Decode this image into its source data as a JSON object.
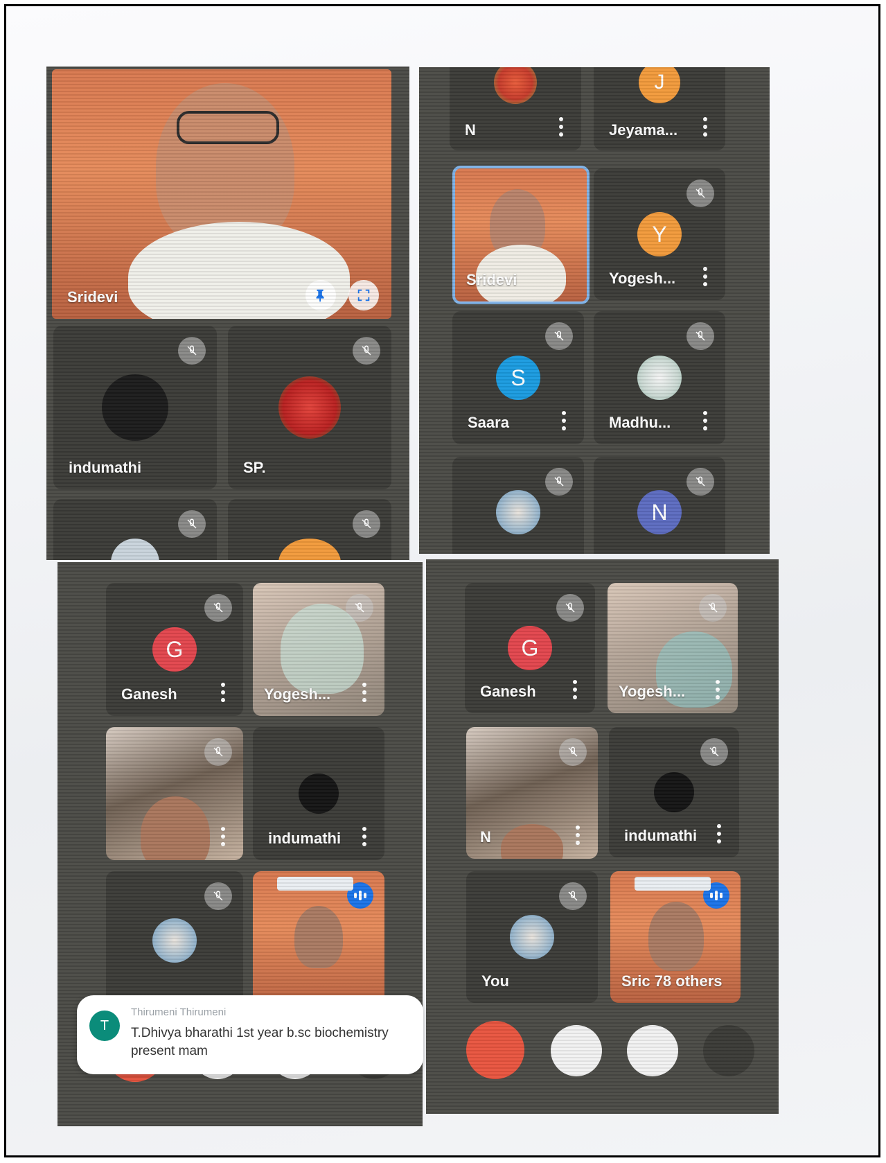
{
  "panel_top_left": {
    "featured": {
      "name": "Sridevi",
      "pin_icon": "pin-icon",
      "fullscreen_icon": "fullscreen-icon"
    },
    "tiles": [
      {
        "name": "indumathi"
      },
      {
        "name": "SP."
      }
    ]
  },
  "panel_top_right": {
    "tiles": [
      {
        "name": "N"
      },
      {
        "name": "Jeyama...",
        "initial": "J"
      },
      {
        "name": "Sridevi"
      },
      {
        "name": "Yogesh...",
        "initial": "Y"
      },
      {
        "name": "Saara",
        "initial": "S"
      },
      {
        "name": "Madhu..."
      },
      {
        "name": ""
      },
      {
        "name": "",
        "initial": "N"
      }
    ]
  },
  "panel_bottom_left": {
    "tiles": [
      {
        "name": "Ganesh",
        "initial": "G"
      },
      {
        "name": "Yogesh..."
      },
      {
        "name": ""
      },
      {
        "name": "indumathi"
      }
    ]
  },
  "panel_bottom_right": {
    "tiles": [
      {
        "name": "Ganesh",
        "initial": "G"
      },
      {
        "name": "Yogesh..."
      },
      {
        "name": "N"
      },
      {
        "name": "indumathi"
      },
      {
        "name": "You"
      },
      {
        "name": "Sric  78 others"
      }
    ]
  },
  "chat_toast": {
    "avatar_initial": "T",
    "sender": "Thirumeni Thirumeni",
    "message": "T.Dhivya bharathi 1st year b.sc biochemistry present mam"
  },
  "colors": {
    "panel": "#4a4a45",
    "tile": "#3b3b37",
    "avatar_orange": "#f29a3b",
    "avatar_blue": "#1a9be0",
    "avatar_red": "#e2454d",
    "avatar_indigo": "#5c6bc0",
    "end_call_red": "#e8553f",
    "speaking_blue": "#1a73e8"
  }
}
